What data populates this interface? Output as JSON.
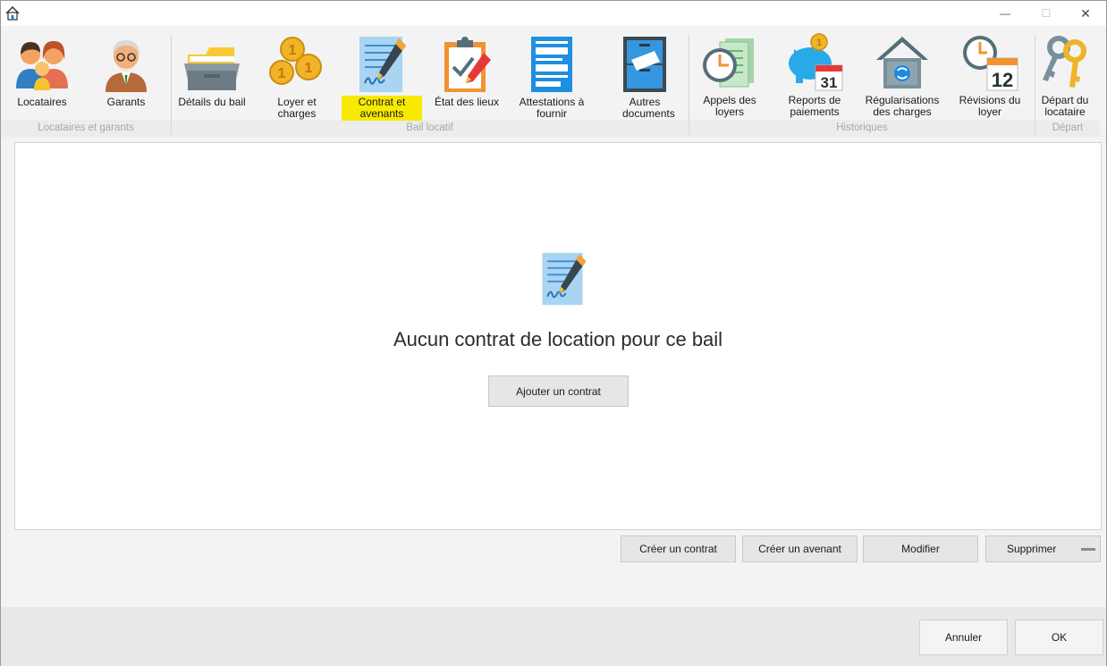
{
  "window": {
    "minimize_glyph": "—",
    "maximize_glyph": "☐",
    "close_glyph": "✕"
  },
  "ribbon": {
    "items": [
      {
        "label": "Locataires",
        "icon": "tenants-icon"
      },
      {
        "label": "Garants",
        "icon": "guarantor-icon"
      },
      {
        "label": "Détails du bail",
        "icon": "lease-details-icon"
      },
      {
        "label": "Loyer et charges",
        "icon": "coins-icon"
      },
      {
        "label": "Contrat et avenants",
        "icon": "contract-icon"
      },
      {
        "label": "État des lieux",
        "icon": "checklist-icon"
      },
      {
        "label": "Attestations à fournir",
        "icon": "attestation-icon"
      },
      {
        "label": "Autres documents",
        "icon": "filing-cabinet-icon"
      },
      {
        "label": "Appels des loyers",
        "icon": "rent-calls-icon"
      },
      {
        "label": "Reports de paiements",
        "icon": "piggy-bank-icon"
      },
      {
        "label": "Régularisations des charges",
        "icon": "charges-regularization-icon"
      },
      {
        "label": "Révisions du loyer",
        "icon": "rent-revision-icon"
      },
      {
        "label": "Départ du locataire",
        "icon": "keys-icon"
      }
    ],
    "groups": [
      {
        "label": "Locataires et garants"
      },
      {
        "label": "Bail locatif"
      },
      {
        "label": "Historiques"
      },
      {
        "label": "Départ"
      }
    ],
    "active_item": "Contrat et avenants",
    "highlight_color": "#f7ea00"
  },
  "main": {
    "empty_message": "Aucun contrat de location pour ce bail",
    "add_button": "Ajouter un contrat"
  },
  "actions": {
    "create": "Créer un contrat",
    "avenant": "Créer un avenant",
    "modify": "Modifier",
    "delete": "Supprimer"
  },
  "footer": {
    "cancel": "Annuler",
    "ok": "OK"
  },
  "icons": {
    "piggy_bank_date": "31",
    "rent_revision_date": "12"
  }
}
